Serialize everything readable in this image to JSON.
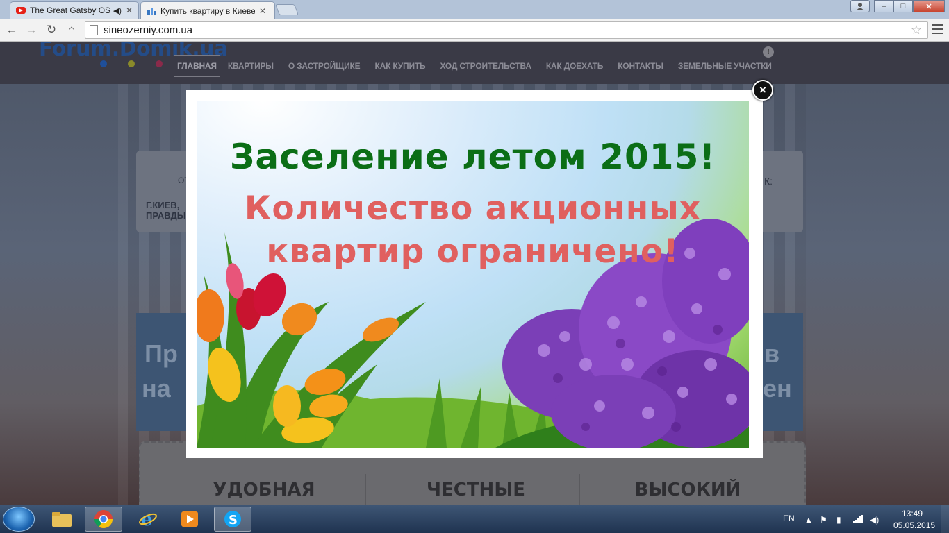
{
  "browser": {
    "tabs": [
      {
        "label": "The Great Gatsby OST",
        "icon": "youtube-icon",
        "audio": "speaker-icon",
        "active": false
      },
      {
        "label": "Купить квартиру в Киеве",
        "icon": "site-icon",
        "active": true
      }
    ],
    "url": "sineozerniy.com.ua",
    "window_buttons": {
      "minimize": "–",
      "maximize": "□",
      "close": "✕"
    }
  },
  "site": {
    "logo": "Forum.Domik.ua",
    "nav": [
      {
        "label": "ГЛАВНАЯ",
        "active": true
      },
      {
        "label": "КВАРТИРЫ"
      },
      {
        "label": "О ЗАСТРОЙЩИКЕ"
      },
      {
        "label": "КАК КУПИТЬ"
      },
      {
        "label": "ХОД СТРОИТЕЛЬСТВА"
      },
      {
        "label": "КАК ДОЕХАТЬ"
      },
      {
        "label": "КОНТАКТЫ"
      },
      {
        "label": "ЗЕМЕЛЬНЫЕ УЧАСТКИ"
      }
    ],
    "info_badge": "!",
    "address_prefix": "ОТ",
    "address_line1": "Г.КИЕВ,",
    "address_line2": "ПРАВДЫ",
    "right_colon": "К:",
    "banner_line1_left": "Пр",
    "banner_line1_right": "в",
    "banner_line2_left": "на",
    "banner_line2_right": "ен",
    "features": [
      "УДОБНАЯ",
      "ЧЕСТНЫЕ",
      "ВЫСОКИЙ"
    ]
  },
  "modal": {
    "line1": "Заселение летом 2015!",
    "line2": "Количество акционных",
    "line3": "квартир ограничено!",
    "close_label": "×"
  },
  "taskbar": {
    "apps": [
      "file-explorer-icon",
      "chrome-icon",
      "internet-explorer-icon",
      "media-player-icon",
      "skype-icon"
    ],
    "language": "EN",
    "time": "13:49",
    "date": "05.05.2015"
  }
}
